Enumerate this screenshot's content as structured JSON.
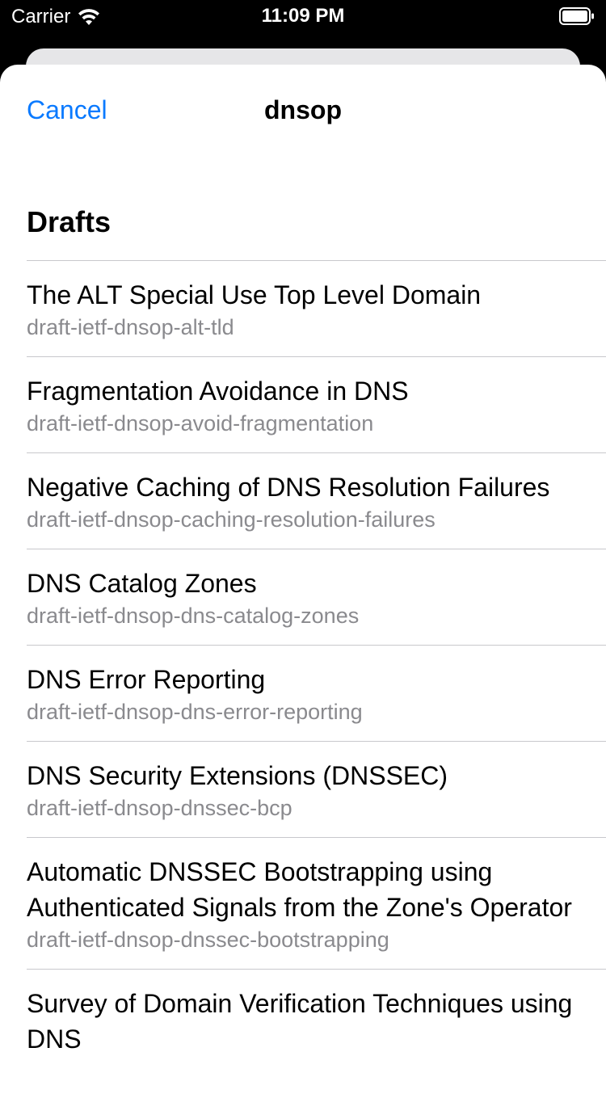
{
  "status_bar": {
    "carrier": "Carrier",
    "time": "11:09 PM",
    "wifi_icon": "wifi-icon",
    "battery_icon": "battery-icon"
  },
  "nav": {
    "cancel_label": "Cancel",
    "title": "dnsop"
  },
  "section": {
    "header": "Drafts"
  },
  "drafts": [
    {
      "title": "The ALT Special Use Top Level Domain",
      "name": "draft-ietf-dnsop-alt-tld"
    },
    {
      "title": "Fragmentation Avoidance in DNS",
      "name": "draft-ietf-dnsop-avoid-fragmentation"
    },
    {
      "title": "Negative Caching of DNS Resolution Failures",
      "name": "draft-ietf-dnsop-caching-resolution-failures"
    },
    {
      "title": "DNS Catalog Zones",
      "name": "draft-ietf-dnsop-dns-catalog-zones"
    },
    {
      "title": "DNS Error Reporting",
      "name": "draft-ietf-dnsop-dns-error-reporting"
    },
    {
      "title": "DNS Security Extensions (DNSSEC)",
      "name": "draft-ietf-dnsop-dnssec-bcp"
    },
    {
      "title": "Automatic DNSSEC Bootstrapping using Authenticated Signals from the Zone's Operator",
      "name": "draft-ietf-dnsop-dnssec-bootstrapping"
    },
    {
      "title": "Survey of Domain Verification Techniques using DNS",
      "name": ""
    }
  ],
  "colors": {
    "accent": "#0a7aff",
    "subtitle": "#8a8a8e",
    "separator": "#c8c8cc"
  }
}
